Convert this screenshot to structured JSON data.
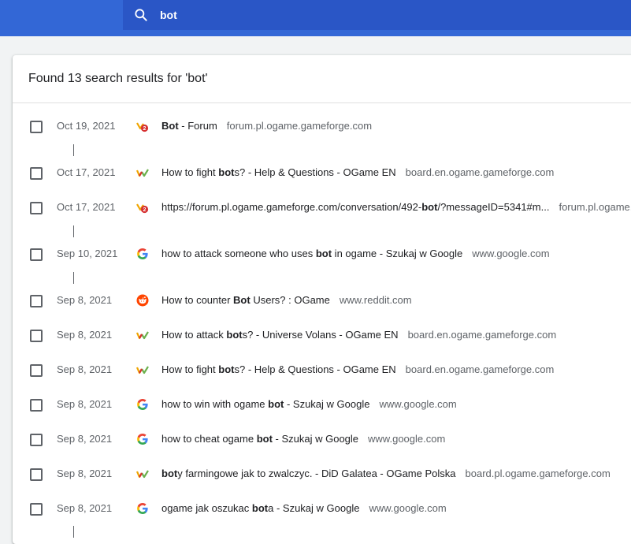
{
  "search": {
    "query": "bot"
  },
  "results_header": "Found 13 search results for 'bot'",
  "rows": [
    {
      "date": "Oct 19, 2021",
      "icon": "ogame-pl-icon",
      "title_parts": [
        [
          "Bot",
          true
        ],
        [
          " - Forum",
          false
        ]
      ],
      "domain": "forum.pl.ogame.gameforge.com"
    },
    {
      "date": "Oct 17, 2021",
      "icon": "gameforge-icon",
      "title_parts": [
        [
          "How to fight ",
          false
        ],
        [
          "bot",
          true
        ],
        [
          "s? - Help & Questions - OGame EN",
          false
        ]
      ],
      "domain": "board.en.ogame.gameforge.com"
    },
    {
      "date": "Oct 17, 2021",
      "icon": "ogame-pl-icon",
      "title_parts": [
        [
          "https://forum.pl.ogame.gameforge.com/conversation/492-",
          false
        ],
        [
          "bot",
          true
        ],
        [
          "/?messageID=5341#m...",
          false
        ]
      ],
      "domain": "forum.pl.ogame.gameforge.com"
    },
    {
      "date": "Sep 10, 2021",
      "icon": "google-icon",
      "title_parts": [
        [
          "how to attack someone who uses ",
          false
        ],
        [
          "bot",
          true
        ],
        [
          " in ogame - Szukaj w Google",
          false
        ]
      ],
      "domain": "www.google.com"
    },
    {
      "date": "Sep 8, 2021",
      "icon": "reddit-icon",
      "title_parts": [
        [
          "How to counter ",
          false
        ],
        [
          "Bot",
          true
        ],
        [
          " Users? : OGame",
          false
        ]
      ],
      "domain": "www.reddit.com"
    },
    {
      "date": "Sep 8, 2021",
      "icon": "gameforge-icon",
      "title_parts": [
        [
          "How to attack ",
          false
        ],
        [
          "bot",
          true
        ],
        [
          "s? - Universe Volans - OGame EN",
          false
        ]
      ],
      "domain": "board.en.ogame.gameforge.com"
    },
    {
      "date": "Sep 8, 2021",
      "icon": "gameforge-icon",
      "title_parts": [
        [
          "How to fight ",
          false
        ],
        [
          "bot",
          true
        ],
        [
          "s? - Help & Questions - OGame EN",
          false
        ]
      ],
      "domain": "board.en.ogame.gameforge.com"
    },
    {
      "date": "Sep 8, 2021",
      "icon": "google-icon",
      "title_parts": [
        [
          "how to win with ogame ",
          false
        ],
        [
          "bot",
          true
        ],
        [
          " - Szukaj w Google",
          false
        ]
      ],
      "domain": "www.google.com"
    },
    {
      "date": "Sep 8, 2021",
      "icon": "google-icon",
      "title_parts": [
        [
          "how to cheat ogame ",
          false
        ],
        [
          "bot",
          true
        ],
        [
          " - Szukaj w Google",
          false
        ]
      ],
      "domain": "www.google.com"
    },
    {
      "date": "Sep 8, 2021",
      "icon": "gameforge-icon",
      "title_parts": [
        [
          "bot",
          true
        ],
        [
          "y farmingowe jak to zwalczyc. - DiD Galatea - OGame Polska",
          false
        ]
      ],
      "domain": "board.pl.ogame.gameforge.com"
    },
    {
      "date": "Sep 8, 2021",
      "icon": "google-icon",
      "title_parts": [
        [
          "ogame jak oszukac ",
          false
        ],
        [
          "bot",
          true
        ],
        [
          "a - Szukaj w Google",
          false
        ]
      ],
      "domain": "www.google.com"
    }
  ],
  "colors": {
    "header_blue": "#3367d6",
    "search_blue": "#2a56c6",
    "text_primary": "#202124",
    "text_secondary": "#5f6368"
  }
}
